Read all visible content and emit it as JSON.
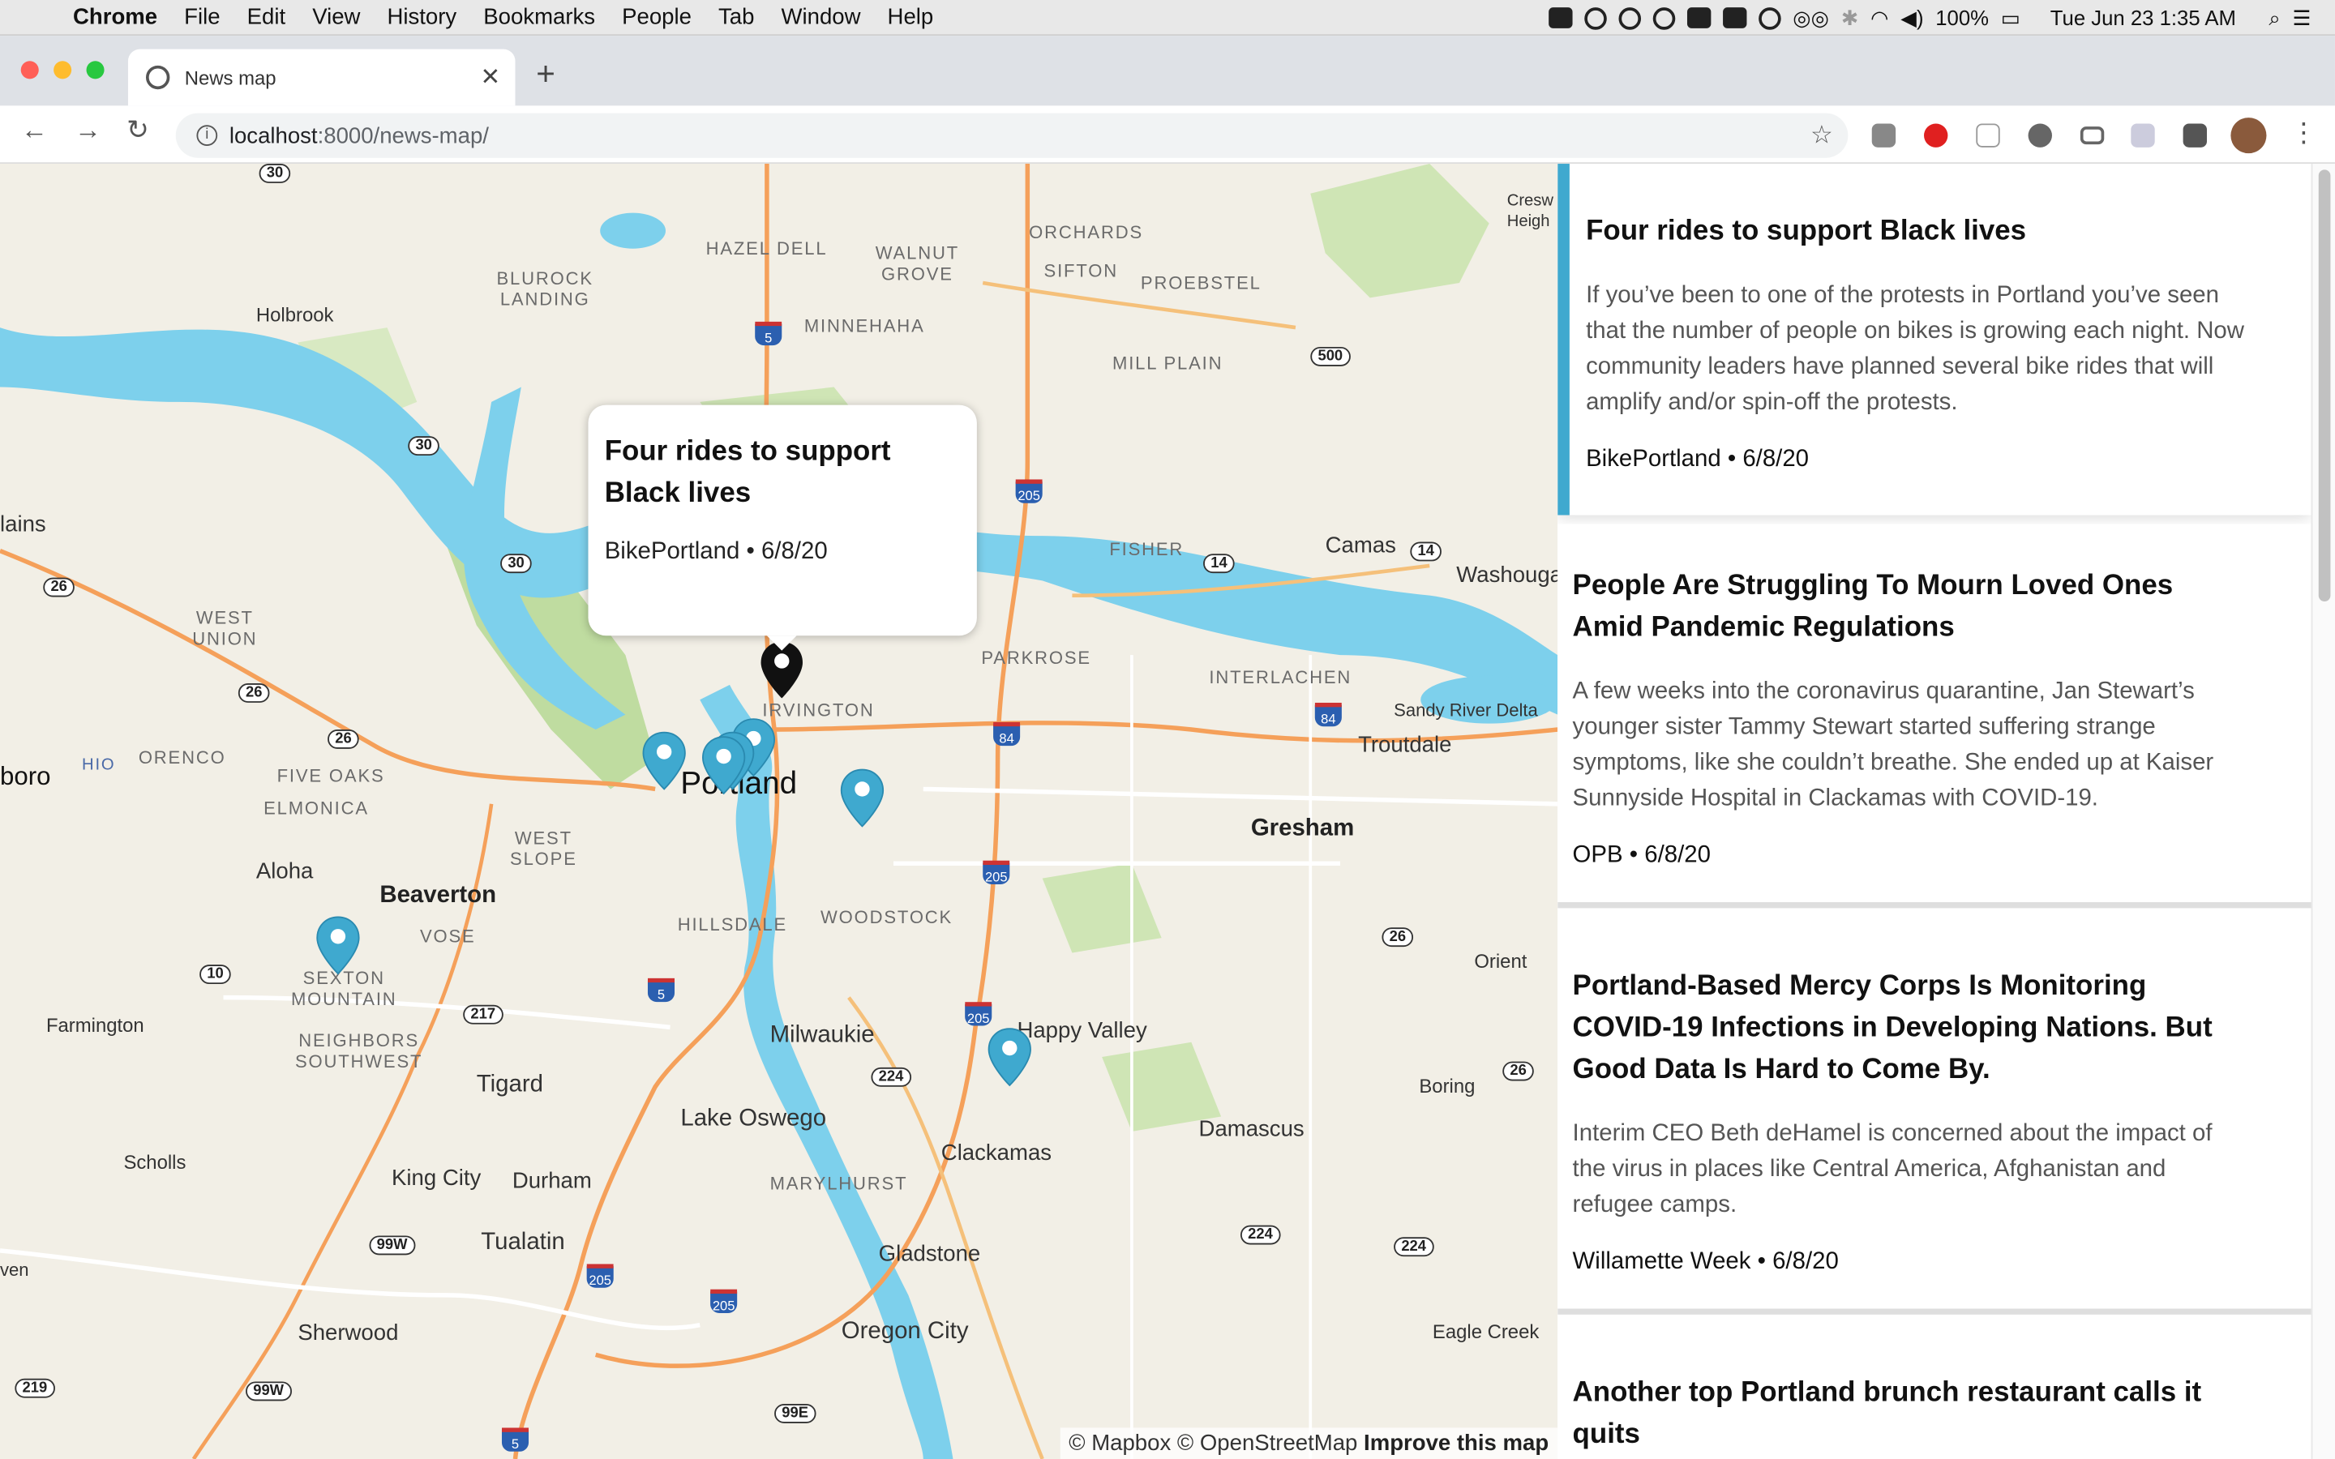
{
  "menubar": {
    "app": "Chrome",
    "items": [
      "File",
      "Edit",
      "View",
      "History",
      "Bookmarks",
      "People",
      "Tab",
      "Window",
      "Help"
    ],
    "battery": "100%",
    "clock": "Tue Jun 23  1:35 AM"
  },
  "tab": {
    "title": "News map"
  },
  "address": {
    "host": "localhost",
    "path": ":8000/news-map/"
  },
  "map": {
    "places": {
      "portland": "Portland",
      "beaverton": "Beaverton",
      "gresham": "Gresham",
      "milwaukie": "Milwaukie",
      "lake_oswego": "Lake Oswego",
      "tigard": "Tigard",
      "clackamas": "Clackamas",
      "happy_valley": "Happy Valley",
      "gladstone": "Gladstone",
      "oregon_city": "Oregon City",
      "tualatin": "Tualatin",
      "durham": "Durham",
      "king_city": "King City",
      "sherwood": "Sherwood",
      "aloha": "Aloha",
      "troutdale": "Troutdale",
      "camas": "Camas",
      "damascus": "Damascus",
      "boring": "Boring",
      "orient": "Orient",
      "eagle_creek": "Eagle Creek",
      "farmington": "Farmington",
      "scholls": "Scholls",
      "holbrook": "Holbrook",
      "sandy_river_delta": "Sandy River Delta",
      "washougal": "Washouga",
      "hillsboro": "boro",
      "plains": "lains",
      "crescent": "Cresw Heigh",
      "ven": "ven"
    },
    "hoods": {
      "hazel_dell": "HAZEL DELL",
      "walnut_grove": "WALNUT GROVE",
      "orchards": "ORCHARDS",
      "sifton": "SIFTON",
      "proebstel": "PROEBSTEL",
      "blurock": "BLUROCK LANDING",
      "minnehaha": "MINNEHAHA",
      "mill_plain": "MILL PLAIN",
      "fisher": "FISHER",
      "parkrose": "PARKROSE",
      "interlachen": "INTERLACHEN",
      "irvington": "IRVINGTON",
      "west_union": "WEST UNION",
      "orenco": "ORENCO",
      "five_oaks": "FIVE OAKS",
      "elmonica": "ELMONICA",
      "west_slope": "WEST SLOPE",
      "hillsdale": "HILLSDALE",
      "woodstock": "WOODSTOCK",
      "vose": "VOSE",
      "sexton": "SEXTON MOUNTAIN",
      "neighbors_sw": "NEIGHBORS SOUTHWEST",
      "marylhurst": "MARYLHURST",
      "hio": "HIO"
    },
    "attribution": {
      "mapbox": "© Mapbox",
      "osm": "© OpenStreetMap",
      "improve": "Improve this map"
    },
    "popup": {
      "title": "Four rides to support Black lives",
      "source": "BikePortland",
      "date": "6/8/20",
      "sep": " • "
    }
  },
  "articles": [
    {
      "title": "Four rides to support Black lives",
      "description": "If you’ve been to one of the protests in Portland you’ve seen that the number of people on bikes is growing each night. Now community leaders have planned several bike rides that will amplify and/or spin-off the protests.",
      "meta": "BikePortland • 6/8/20"
    },
    {
      "title": "People Are Struggling To Mourn Loved Ones Amid Pandemic Regulations",
      "description": "A few weeks into the coronavirus quarantine, Jan Stewart’s younger sister Tammy Stewart started suffering strange symptoms, like she couldn’t breathe. She ended up at Kaiser Sunnyside Hospital in Clackamas with COVID-19.",
      "meta": "OPB • 6/8/20"
    },
    {
      "title": "Portland-Based Mercy Corps Is Monitoring COVID-19 Infections in Developing Nations. But Good Data Is Hard to Come By.",
      "description": "Interim CEO Beth deHamel is concerned about the impact of the virus in places like Central America, Afghanistan and refugee camps.",
      "meta": "Willamette Week • 6/8/20"
    },
    {
      "title": "Another top Portland brunch restaurant calls it quits",
      "description": "",
      "meta": ""
    }
  ],
  "colors": {
    "accent": "#3fa9cf",
    "pin": "#3fa9cf",
    "pin_active": "#111111",
    "water": "#7dd0ec",
    "park": "#cfe5b5"
  }
}
